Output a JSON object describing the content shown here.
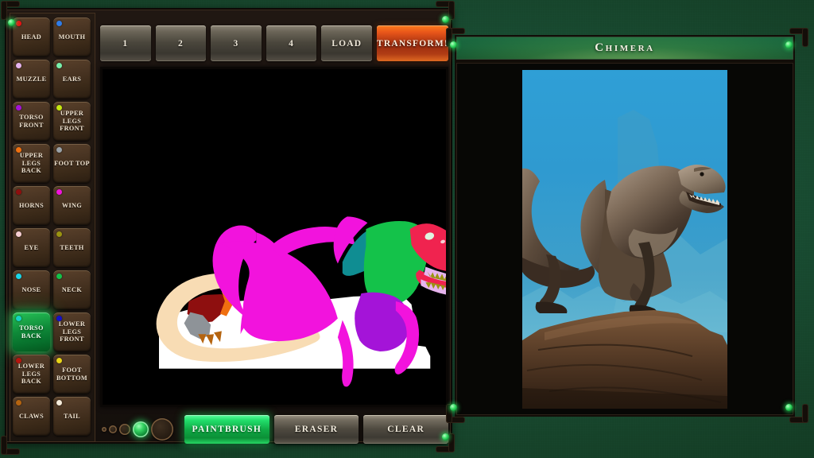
{
  "app": {
    "background_color": "#17472f",
    "result_title": "Chimera"
  },
  "sidebar": {
    "parts": [
      {
        "label": "HEAD",
        "color": "#e81414"
      },
      {
        "label": "MOUTH",
        "color": "#2f7ce8"
      },
      {
        "label": "MUZZLE",
        "color": "#e6b4ee"
      },
      {
        "label": "EARS",
        "color": "#79f0ab"
      },
      {
        "label": "TORSO FRONT",
        "color": "#a414d8"
      },
      {
        "label": "UPPER LEGS FRONT",
        "color": "#c6e810"
      },
      {
        "label": "UPPER LEGS BACK",
        "color": "#f07010"
      },
      {
        "label": "FOOT TOP",
        "color": "#9aa2a8"
      },
      {
        "label": "HORNS",
        "color": "#8e0f0f"
      },
      {
        "label": "WING",
        "color": "#f213dd"
      },
      {
        "label": "EYE",
        "color": "#f7cfd4"
      },
      {
        "label": "TEETH",
        "color": "#9a9411"
      },
      {
        "label": "NOSE",
        "color": "#1ad6e8"
      },
      {
        "label": "NECK",
        "color": "#14c24a"
      },
      {
        "label": "TORSO BACK",
        "color": "#17d4c6",
        "selected": true
      },
      {
        "label": "LOWER LEGS FRONT",
        "color": "#1310c8"
      },
      {
        "label": "LOWER LEGS BACK",
        "color": "#b5150f"
      },
      {
        "label": "FOOT BOTTOM",
        "color": "#e8d618"
      },
      {
        "label": "CLAWS",
        "color": "#b56410"
      },
      {
        "label": "TAIL",
        "color": "#f6ecdc"
      }
    ]
  },
  "toolbar": {
    "slots": [
      "1",
      "2",
      "3",
      "4"
    ],
    "load_label": "LOAD",
    "transform_label": "TRANSFORM!",
    "transform_color": "#c4400f"
  },
  "tools": {
    "brush_sizes": [
      6,
      10,
      14,
      20,
      28
    ],
    "active_brush_index": 3,
    "paintbrush_label": "PAINTBRUSH",
    "eraser_label": "ERASER",
    "clear_label": "CLEAR",
    "active_tool": "PAINTBRUSH",
    "active_color": "#2fd96a"
  },
  "canvas": {
    "background_color": "#000000",
    "description": "Segmentation map sketch of a winged dinosaur-like chimera standing on a white rock"
  }
}
